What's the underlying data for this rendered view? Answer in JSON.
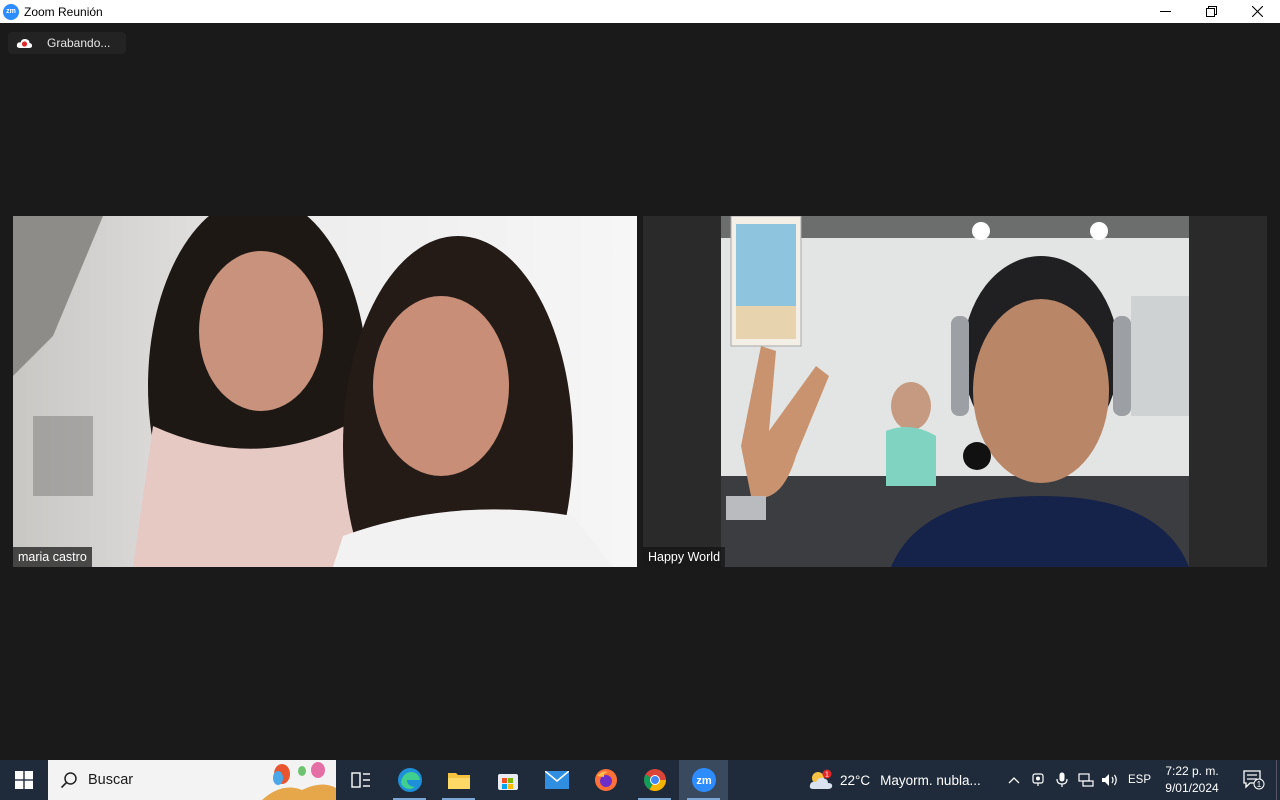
{
  "window": {
    "title": "Zoom Reunión",
    "app_logo_text": "zm",
    "controls": [
      "minimize",
      "restore",
      "close"
    ]
  },
  "recording": {
    "label": "Grabando..."
  },
  "participants": [
    {
      "name": "maria castro"
    },
    {
      "name": "Happy World"
    }
  ],
  "taskbar": {
    "search_placeholder": "Buscar",
    "apps": [
      "task-view",
      "edge",
      "file-explorer",
      "microsoft-store",
      "mail",
      "firefox",
      "chrome",
      "zoom"
    ],
    "zoom_icon_text": "zm",
    "weather": {
      "temp": "22°C",
      "desc": "Mayorm. nubla...",
      "alert_count": "1"
    },
    "language": "ESP",
    "time": "7:22 p. m.",
    "date": "9/01/2024",
    "notification_count": "1"
  },
  "colors": {
    "background": "#1a1a1a",
    "zoom_blue": "#2d8cff",
    "taskbar": "#1f2b3a",
    "recording_red": "#e02828"
  }
}
